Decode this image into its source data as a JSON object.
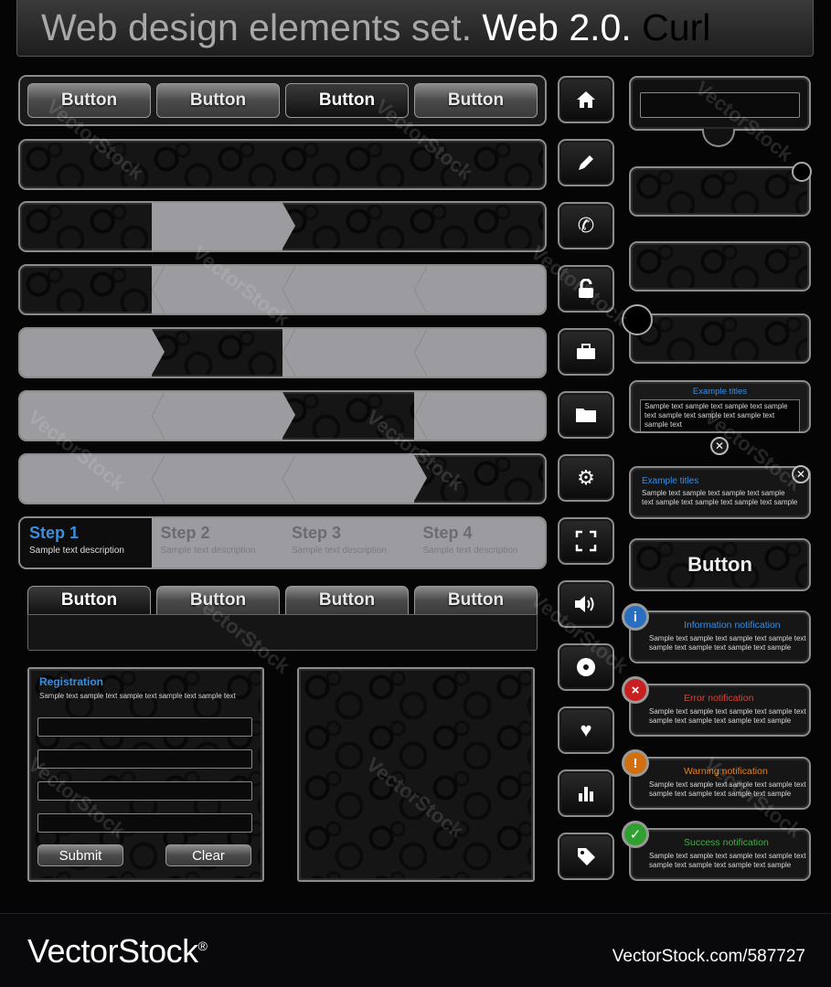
{
  "header": {
    "part1": "Web design elements set.",
    "part2": "Web 2.0.",
    "part3": "Curl"
  },
  "tabs_top": [
    "Button",
    "Button",
    "Button",
    "Button"
  ],
  "tabs_bottom": [
    "Button",
    "Button",
    "Button",
    "Button"
  ],
  "steps": [
    {
      "title": "Step 1",
      "desc": "Sample text description"
    },
    {
      "title": "Step 2",
      "desc": "Sample text description"
    },
    {
      "title": "Step 3",
      "desc": "Sample text description"
    },
    {
      "title": "Step 4",
      "desc": "Sample text description"
    }
  ],
  "registration": {
    "title": "Registration",
    "desc": "Sample text sample text  sample text sample text sample text",
    "submit": "Submit",
    "clear": "Clear"
  },
  "side_icons": [
    "home-icon",
    "pencil-icon",
    "phone-icon",
    "unlock-icon",
    "briefcase-icon",
    "folder-icon",
    "gear-icon",
    "fullscreen-icon",
    "speaker-icon",
    "disc-icon",
    "heart-icon",
    "bar-chart-icon",
    "tag-icon"
  ],
  "boxes": {
    "example1_title": "Example titles",
    "example1_text": "Sample text sample text  sample text sample text sample text sample text sample text sample text",
    "example2_title": "Example titles",
    "example2_text": "Sample text sample text sample text sample text sample text sample text sample text sample",
    "big_button": "Button"
  },
  "notifications": [
    {
      "title": "Information notification",
      "text": "Sample text sample text  sample text sample text sample text sample text sample text sample",
      "color": "#3a8ee0",
      "icon": "i"
    },
    {
      "title": "Error notification",
      "text": "Sample text sample text  sample text sample text sample text sample text sample text sample",
      "color": "#e04030",
      "icon": "×"
    },
    {
      "title": "Warning notification",
      "text": "Sample text sample text  sample text sample text sample text sample text sample text sample",
      "color": "#e08020",
      "icon": "!"
    },
    {
      "title": "Success notification",
      "text": "Sample text sample text  sample text sample text sample text sample text sample text sample",
      "color": "#40b040",
      "icon": "✓"
    }
  ],
  "footer": {
    "brand": "VectorStock",
    "reg": "®",
    "url": "VectorStock.com/587727"
  },
  "watermark": "VectorStock"
}
